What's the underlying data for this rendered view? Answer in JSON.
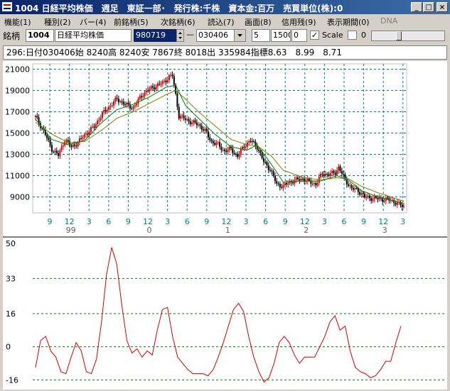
{
  "window": {
    "title": "1004 日経平均株価　週足　東証一部･　発行株:千株　資本金:百万　売買単位(株):0",
    "min_glyph": "_",
    "max_glyph": "□",
    "close_glyph": "×"
  },
  "menu": [
    "機能(1)",
    "種別(2)",
    "バー(4)",
    "前銘柄(5)",
    "次銘柄(6)",
    "読込(7)",
    "画面(8)",
    "信用残(9)",
    "表示期間(0)",
    "DNA"
  ],
  "toolbar": {
    "label": "銘柄",
    "code": "1004",
    "name": "日経平均株価",
    "code_value": "980719",
    "dash": "—",
    "date": "030406",
    "period": "5",
    "count": "1500",
    "offset": "0",
    "check_mark": "✓",
    "scale_label": "Scale",
    "scale_value": "0"
  },
  "info": {
    "text": "296:日付030406始 8240高 8240安 7867終 8018出 335984指標8.63　8.99　8.71"
  },
  "colors": {
    "up": "#d40000",
    "down": "#000000",
    "ma_short": "#008000",
    "ma_long": "#808000",
    "grid": "#008080",
    "osc": "#d40000",
    "osc_grid": "#008000"
  },
  "chart_data": [
    {
      "type": "candlestick",
      "title": "",
      "ylim": [
        7500,
        21500
      ],
      "y_ticks": [
        21000,
        19000,
        17000,
        15000,
        13000,
        11000,
        9000
      ],
      "x_month_labels": [
        "9",
        "12",
        "3",
        "6",
        "9",
        "12",
        "3",
        "6",
        "9",
        "12",
        "3",
        "6",
        "9",
        "12",
        "3",
        "6",
        "9",
        "12",
        "3"
      ],
      "x_year_labels": [
        {
          "label": "99",
          "after_month_index": 1
        },
        {
          "label": "0",
          "after_month_index": 5
        },
        {
          "label": "1",
          "after_month_index": 9
        },
        {
          "label": "2",
          "after_month_index": 13
        },
        {
          "label": "3",
          "after_month_index": 17
        }
      ],
      "close_keypoints": [
        [
          0,
          16500
        ],
        [
          5,
          15200
        ],
        [
          10,
          13500
        ],
        [
          14,
          12900
        ],
        [
          18,
          14400
        ],
        [
          22,
          13700
        ],
        [
          26,
          14100
        ],
        [
          30,
          14800
        ],
        [
          36,
          15600
        ],
        [
          40,
          16600
        ],
        [
          44,
          17300
        ],
        [
          50,
          18200
        ],
        [
          56,
          17600
        ],
        [
          60,
          17400
        ],
        [
          66,
          18700
        ],
        [
          72,
          19300
        ],
        [
          78,
          19700
        ],
        [
          82,
          20300
        ],
        [
          84,
          20400
        ],
        [
          86,
          18600
        ],
        [
          88,
          16600
        ],
        [
          92,
          16300
        ],
        [
          96,
          16000
        ],
        [
          100,
          15800
        ],
        [
          104,
          15200
        ],
        [
          108,
          14200
        ],
        [
          112,
          13900
        ],
        [
          116,
          13300
        ],
        [
          120,
          13500
        ],
        [
          124,
          12800
        ],
        [
          128,
          13800
        ],
        [
          132,
          14300
        ],
        [
          136,
          13700
        ],
        [
          140,
          12300
        ],
        [
          144,
          11600
        ],
        [
          148,
          10200
        ],
        [
          152,
          10000
        ],
        [
          156,
          10400
        ],
        [
          160,
          10600
        ],
        [
          164,
          10700
        ],
        [
          168,
          10400
        ],
        [
          172,
          10200
        ],
        [
          176,
          11200
        ],
        [
          180,
          11100
        ],
        [
          184,
          11300
        ],
        [
          186,
          11800
        ],
        [
          190,
          10600
        ],
        [
          194,
          9800
        ],
        [
          198,
          9600
        ],
        [
          202,
          9000
        ],
        [
          206,
          8900
        ],
        [
          212,
          8800
        ],
        [
          218,
          8700
        ],
        [
          222,
          8400
        ],
        [
          226,
          8050
        ]
      ],
      "ma_short_keypoints": [
        [
          0,
          16300
        ],
        [
          10,
          14400
        ],
        [
          20,
          13900
        ],
        [
          30,
          14300
        ],
        [
          40,
          15900
        ],
        [
          50,
          17200
        ],
        [
          60,
          17700
        ],
        [
          70,
          18400
        ],
        [
          80,
          19300
        ],
        [
          86,
          19500
        ],
        [
          92,
          17600
        ],
        [
          100,
          16400
        ],
        [
          110,
          14900
        ],
        [
          120,
          13700
        ],
        [
          130,
          13400
        ],
        [
          136,
          13900
        ],
        [
          145,
          12000
        ],
        [
          152,
          10400
        ],
        [
          165,
          10500
        ],
        [
          175,
          10500
        ],
        [
          185,
          11000
        ],
        [
          192,
          10600
        ],
        [
          200,
          9600
        ],
        [
          210,
          9000
        ],
        [
          220,
          8600
        ],
        [
          226,
          8400
        ]
      ],
      "ma_long_keypoints": [
        [
          0,
          16000
        ],
        [
          10,
          14900
        ],
        [
          20,
          14100
        ],
        [
          30,
          14200
        ],
        [
          40,
          15200
        ],
        [
          50,
          16400
        ],
        [
          60,
          17000
        ],
        [
          70,
          17800
        ],
        [
          80,
          18600
        ],
        [
          86,
          19000
        ],
        [
          92,
          18200
        ],
        [
          100,
          17000
        ],
        [
          110,
          15700
        ],
        [
          120,
          14400
        ],
        [
          130,
          13900
        ],
        [
          136,
          13800
        ],
        [
          145,
          12800
        ],
        [
          152,
          11500
        ],
        [
          165,
          10800
        ],
        [
          175,
          10600
        ],
        [
          185,
          10800
        ],
        [
          192,
          10700
        ],
        [
          200,
          10000
        ],
        [
          210,
          9400
        ],
        [
          220,
          8900
        ],
        [
          226,
          8600
        ]
      ]
    },
    {
      "type": "line",
      "title": "",
      "ylim": [
        -20,
        52
      ],
      "y_ticks": [
        50,
        33,
        16,
        0,
        -16
      ],
      "values": [
        -10,
        3,
        5,
        -2,
        -5,
        -12,
        -13,
        -5,
        2,
        -2,
        -12,
        -13,
        -6,
        12,
        35,
        48,
        40,
        20,
        3,
        -3,
        -1,
        -5,
        -2,
        -4,
        8,
        18,
        19,
        5,
        -5,
        -8,
        -11,
        -13,
        -13,
        -13,
        -14,
        -11,
        -5,
        2,
        10,
        18,
        21,
        17,
        5,
        -5,
        -12,
        -17,
        -15,
        -8,
        2,
        5,
        2,
        -4,
        -8,
        -5,
        -5,
        -5,
        0,
        5,
        12,
        15,
        8,
        10,
        -2,
        -10,
        -12,
        -13,
        -15,
        -14,
        -11,
        -7,
        -7,
        2,
        10
      ]
    }
  ]
}
